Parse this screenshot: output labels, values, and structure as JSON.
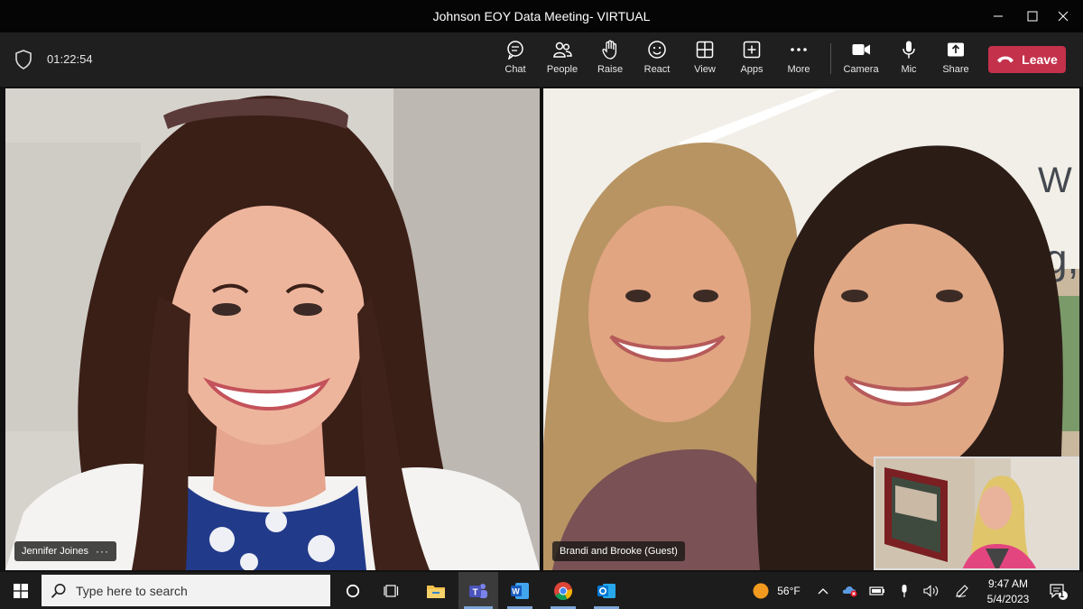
{
  "window": {
    "title": "Johnson EOY Data Meeting- VIRTUAL",
    "controls": [
      "minimize-icon",
      "maximize-icon",
      "close-icon"
    ]
  },
  "toolbar": {
    "timer": "01:22:54",
    "buttons": [
      {
        "label": "Chat",
        "icon": "chat-icon"
      },
      {
        "label": "People",
        "icon": "people-icon"
      },
      {
        "label": "Raise",
        "icon": "raise-hand-icon"
      },
      {
        "label": "React",
        "icon": "smile-icon"
      },
      {
        "label": "View",
        "icon": "grid-icon"
      },
      {
        "label": "Apps",
        "icon": "plus-square-icon"
      },
      {
        "label": "More",
        "icon": "more-icon"
      }
    ],
    "media": [
      {
        "label": "Camera",
        "icon": "camera-icon"
      },
      {
        "label": "Mic",
        "icon": "mic-icon"
      },
      {
        "label": "Share",
        "icon": "share-icon"
      }
    ],
    "leave_label": "Leave",
    "leave_color": "#c4314b"
  },
  "participants": [
    {
      "name": "Jennifer Joines",
      "more": "···"
    },
    {
      "name": "Brandi and Brooke (Guest)"
    }
  ],
  "taskbar": {
    "search_placeholder": "Type here to search",
    "weather": "56°F",
    "time": "9:47 AM",
    "date": "5/4/2023",
    "notification_count": "1",
    "apps": [
      "task-view-icon",
      "file-explorer-icon",
      "teams-icon",
      "word-icon",
      "chrome-icon",
      "outlook-icon"
    ]
  }
}
